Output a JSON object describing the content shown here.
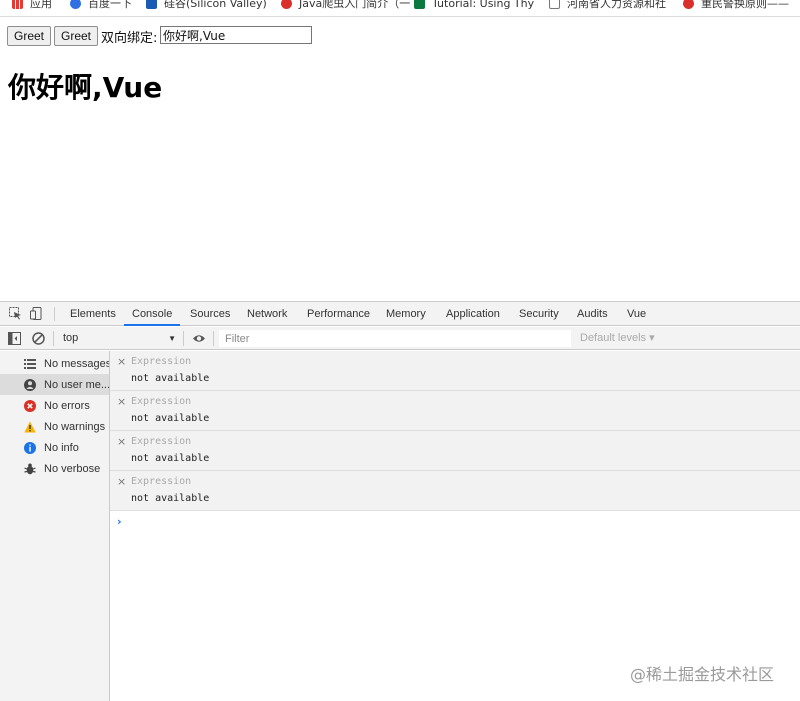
{
  "bookmarks": [
    {
      "label": "应用",
      "icon": "apps-icon"
    },
    {
      "label": "百度一下",
      "icon": "baidu-icon"
    },
    {
      "label": "硅谷(Silicon Valley)",
      "icon": "bookmark-icon"
    },
    {
      "label": "Java爬虫入门简介（一",
      "icon": "csdn-icon"
    },
    {
      "label": "Tutorial: Using Thy",
      "icon": "bookmark-icon"
    },
    {
      "label": "河南省人力资源和社",
      "icon": "page-icon"
    },
    {
      "label": "重民警换原则——",
      "icon": "csdn-icon"
    }
  ],
  "page": {
    "greet_button_1": "Greet",
    "greet_button_2": "Greet",
    "binding_label": "双向绑定:",
    "binding_input_value": "你好啊,Vue",
    "heading": "你好啊,Vue"
  },
  "devtools": {
    "tabs": [
      "Elements",
      "Console",
      "Sources",
      "Network",
      "Performance",
      "Memory",
      "Application",
      "Security",
      "Audits",
      "Vue"
    ],
    "active_tab": "Console",
    "context_select": "top",
    "filter_placeholder": "Filter",
    "levels_label": "Default levels ▾",
    "sidebar": [
      {
        "label": "No messages",
        "icon": "list-icon"
      },
      {
        "label": "No user me...",
        "icon": "user-icon"
      },
      {
        "label": "No errors",
        "icon": "error-icon"
      },
      {
        "label": "No warnings",
        "icon": "warning-icon"
      },
      {
        "label": "No info",
        "icon": "info-icon"
      },
      {
        "label": "No verbose",
        "icon": "bug-icon"
      }
    ],
    "selected_sidebar_item": "No user me...",
    "expressions": [
      {
        "name": "Expression",
        "value": "not available"
      },
      {
        "name": "Expression",
        "value": "not available"
      },
      {
        "name": "Expression",
        "value": "not available"
      },
      {
        "name": "Expression",
        "value": "not available"
      }
    ],
    "prompt_symbol": "›",
    "close_symbol": "×"
  },
  "watermark": "@稀土掘金技术社区",
  "colors": {
    "accent": "#1a73e8",
    "error": "#d93025",
    "warning": "#f4b400",
    "info": "#1a73e8"
  }
}
